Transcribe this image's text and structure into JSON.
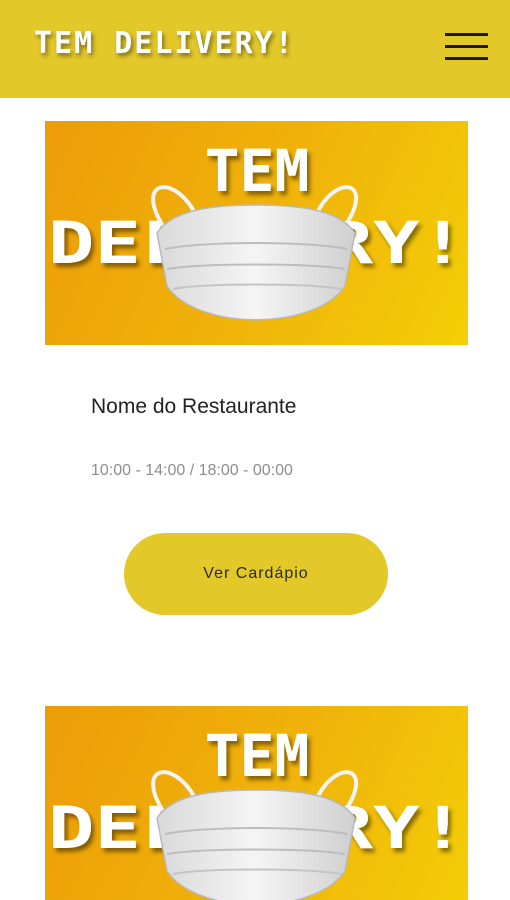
{
  "header": {
    "brand": "TEM DELIVERY!",
    "menu_icon": "hamburger-menu-icon",
    "background": "#e3c82a"
  },
  "restaurants": [
    {
      "banner_line1": "TEM",
      "banner_line2": "DELIVERY!",
      "name": "Nome do Restaurante",
      "hours": "10:00 - 14:00 / 18:00 - 00:00",
      "button_label": "Ver Cardápio"
    },
    {
      "banner_line1": "TEM",
      "banner_line2": "DELIVERY!"
    }
  ],
  "colors": {
    "accent": "#e3c82a",
    "banner_orange": "#ec9c08",
    "banner_yellow": "#f4cf06"
  }
}
